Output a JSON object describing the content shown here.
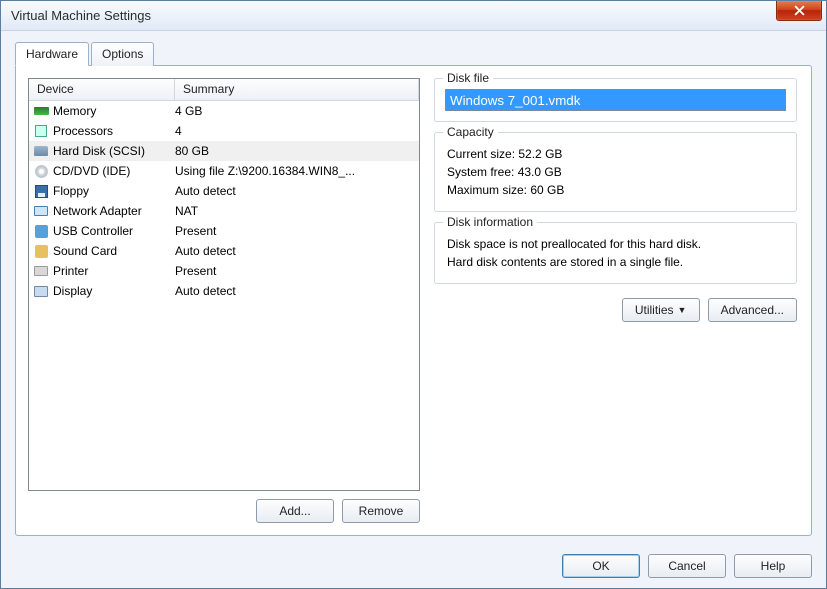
{
  "window": {
    "title": "Virtual Machine Settings"
  },
  "tabs": {
    "hardware": "Hardware",
    "options": "Options"
  },
  "table": {
    "col_device": "Device",
    "col_summary": "Summary",
    "rows": [
      {
        "icon": "memory-icon",
        "device": "Memory",
        "summary": "4 GB"
      },
      {
        "icon": "cpu-icon",
        "device": "Processors",
        "summary": "4"
      },
      {
        "icon": "hdd-icon",
        "device": "Hard Disk (SCSI)",
        "summary": "80 GB",
        "selected": true
      },
      {
        "icon": "cd-icon",
        "device": "CD/DVD (IDE)",
        "summary": "Using file Z:\\9200.16384.WIN8_..."
      },
      {
        "icon": "floppy-icon",
        "device": "Floppy",
        "summary": "Auto detect"
      },
      {
        "icon": "network-icon",
        "device": "Network Adapter",
        "summary": "NAT"
      },
      {
        "icon": "usb-icon",
        "device": "USB Controller",
        "summary": "Present"
      },
      {
        "icon": "sound-icon",
        "device": "Sound Card",
        "summary": "Auto detect"
      },
      {
        "icon": "printer-icon",
        "device": "Printer",
        "summary": "Present"
      },
      {
        "icon": "display-icon",
        "device": "Display",
        "summary": "Auto detect"
      }
    ]
  },
  "left_buttons": {
    "add": "Add...",
    "remove": "Remove"
  },
  "disk_file": {
    "legend": "Disk file",
    "value": "Windows 7_001.vmdk"
  },
  "capacity": {
    "legend": "Capacity",
    "current_label": "Current size:",
    "current_value": "52.2 GB",
    "free_label": "System free:",
    "free_value": "43.0 GB",
    "max_label": "Maximum size:",
    "max_value": "60 GB"
  },
  "disk_info": {
    "legend": "Disk information",
    "line1": "Disk space is not preallocated for this hard disk.",
    "line2": "Hard disk contents are stored in a single file."
  },
  "right_buttons": {
    "utilities": "Utilities",
    "advanced": "Advanced..."
  },
  "footer": {
    "ok": "OK",
    "cancel": "Cancel",
    "help": "Help"
  }
}
